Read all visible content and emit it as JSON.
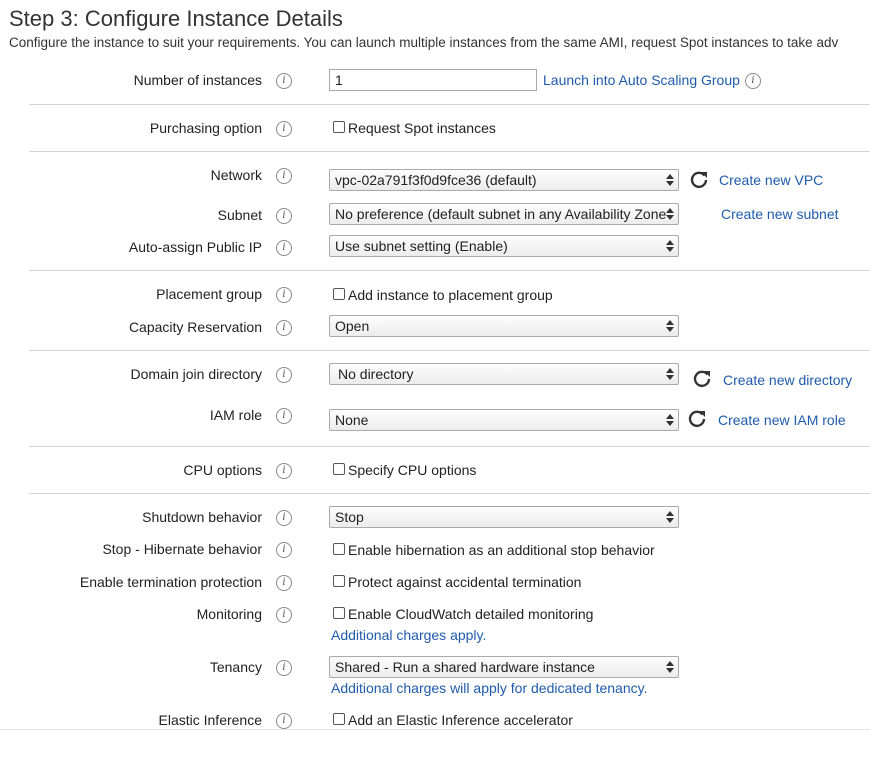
{
  "header": {
    "title": "Step 3: Configure Instance Details",
    "subtitle": "Configure the instance to suit your requirements. You can launch multiple instances from the same AMI, request Spot instances to take adv"
  },
  "fields": {
    "num_instances": {
      "label": "Number of instances",
      "value": "1",
      "link": "Launch into Auto Scaling Group"
    },
    "purchasing": {
      "label": "Purchasing option",
      "checkbox": "Request Spot instances"
    },
    "network": {
      "label": "Network",
      "value": "vpc-02a791f3f0d9fce36 (default)",
      "link": "Create new VPC"
    },
    "subnet": {
      "label": "Subnet",
      "value": "No preference (default subnet in any Availability Zone",
      "link": "Create new subnet"
    },
    "public_ip": {
      "label": "Auto-assign Public IP",
      "value": "Use subnet setting (Enable)"
    },
    "placement": {
      "label": "Placement group",
      "checkbox": "Add instance to placement group"
    },
    "capacity": {
      "label": "Capacity Reservation",
      "value": "Open"
    },
    "domain": {
      "label": "Domain join directory",
      "value": "No directory",
      "link": "Create new directory"
    },
    "iam": {
      "label": "IAM role",
      "value": "None",
      "link": "Create new IAM role"
    },
    "cpu": {
      "label": "CPU options",
      "checkbox": "Specify CPU options"
    },
    "shutdown": {
      "label": "Shutdown behavior",
      "value": "Stop"
    },
    "hibernate": {
      "label": "Stop - Hibernate behavior",
      "checkbox": "Enable hibernation as an additional stop behavior"
    },
    "termination": {
      "label": "Enable termination protection",
      "checkbox": "Protect against accidental termination"
    },
    "monitoring": {
      "label": "Monitoring",
      "checkbox": "Enable CloudWatch detailed monitoring",
      "note": "Additional charges apply."
    },
    "tenancy": {
      "label": "Tenancy",
      "value": "Shared - Run a shared hardware instance",
      "note": "Additional charges will apply for dedicated tenancy."
    },
    "elastic": {
      "label": "Elastic Inference",
      "checkbox": "Add an Elastic Inference accelerator"
    }
  },
  "icons": {
    "info": "i"
  },
  "colors": {
    "link": "#1f5bad",
    "divider": "#d5d5d5"
  }
}
